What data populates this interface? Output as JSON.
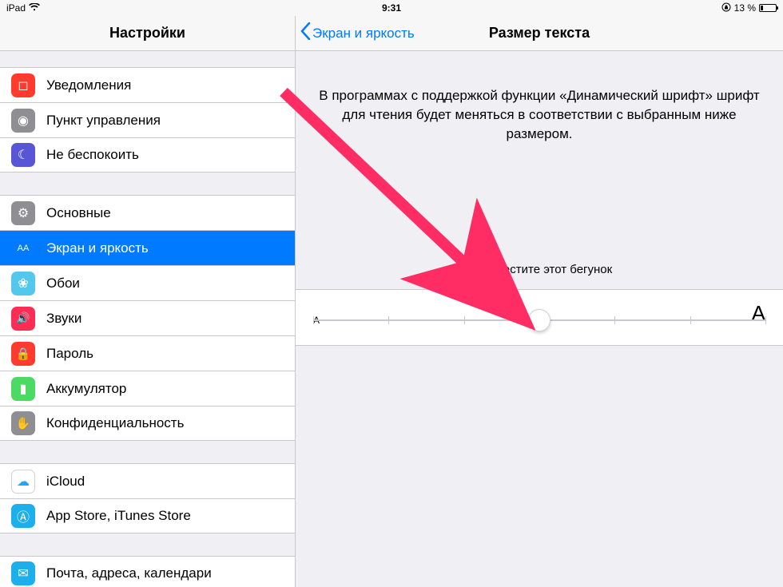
{
  "statusbar": {
    "device": "iPad",
    "time": "9:31",
    "battery_text": "13 %",
    "battery_pct": 13,
    "orientation_lock": "⦿"
  },
  "sidebar": {
    "title": "Настройки",
    "groups": [
      {
        "items": [
          {
            "label": "Уведомления",
            "name": "notifications",
            "icon_bg": "#ff3b30",
            "glyph": "◻"
          },
          {
            "label": "Пункт управления",
            "name": "control-center",
            "icon_bg": "#8e8e93",
            "glyph": "◉"
          },
          {
            "label": "Не беспокоить",
            "name": "do-not-disturb",
            "icon_bg": "#5856d6",
            "glyph": "☾"
          }
        ]
      },
      {
        "items": [
          {
            "label": "Основные",
            "name": "general",
            "icon_bg": "#8e8e93",
            "glyph": "⚙"
          },
          {
            "label": "Экран и яркость",
            "name": "display-brightness",
            "icon_bg": "#007aff",
            "glyph": "AA",
            "selected": true,
            "glyph_size": "11px"
          },
          {
            "label": "Обои",
            "name": "wallpaper",
            "icon_bg": "#54c7ec",
            "glyph": "❀"
          },
          {
            "label": "Звуки",
            "name": "sounds",
            "icon_bg": "#ff2d55",
            "glyph": "🔊",
            "glyph_size": "14px"
          },
          {
            "label": "Пароль",
            "name": "passcode",
            "icon_bg": "#ff3b30",
            "glyph": "🔒",
            "glyph_size": "15px"
          },
          {
            "label": "Аккумулятор",
            "name": "battery",
            "icon_bg": "#4cd964",
            "glyph": "▮"
          },
          {
            "label": "Конфиденциальность",
            "name": "privacy",
            "icon_bg": "#8e8e93",
            "glyph": "✋",
            "glyph_size": "15px"
          }
        ]
      },
      {
        "items": [
          {
            "label": "iCloud",
            "name": "icloud",
            "icon_bg": "#ffffff",
            "glyph": "☁",
            "glyph_color": "#1fa7ff",
            "border": "#d1d1d6"
          },
          {
            "label": "App Store, iTunes Store",
            "name": "app-store",
            "icon_bg": "#1dafec",
            "glyph": "Ⓐ"
          }
        ]
      },
      {
        "items": [
          {
            "label": "Почта, адреса, календари",
            "name": "mail",
            "icon_bg": "#1dafec",
            "glyph": "✉"
          }
        ]
      }
    ]
  },
  "detail": {
    "back_label": "Экран и яркость",
    "title": "Размер текста",
    "explanation": "В программах с поддержкой функции «Динамический шрифт» шрифт для чтения будет меняться в соответствии с выбранным ниже размером.",
    "slider_caption": "Переместите этот бегунок",
    "slider": {
      "min_label": "A",
      "max_label": "A",
      "steps": 7,
      "value_index": 3
    }
  },
  "colors": {
    "accent": "#007aff",
    "arrow": "#ff2d63"
  }
}
